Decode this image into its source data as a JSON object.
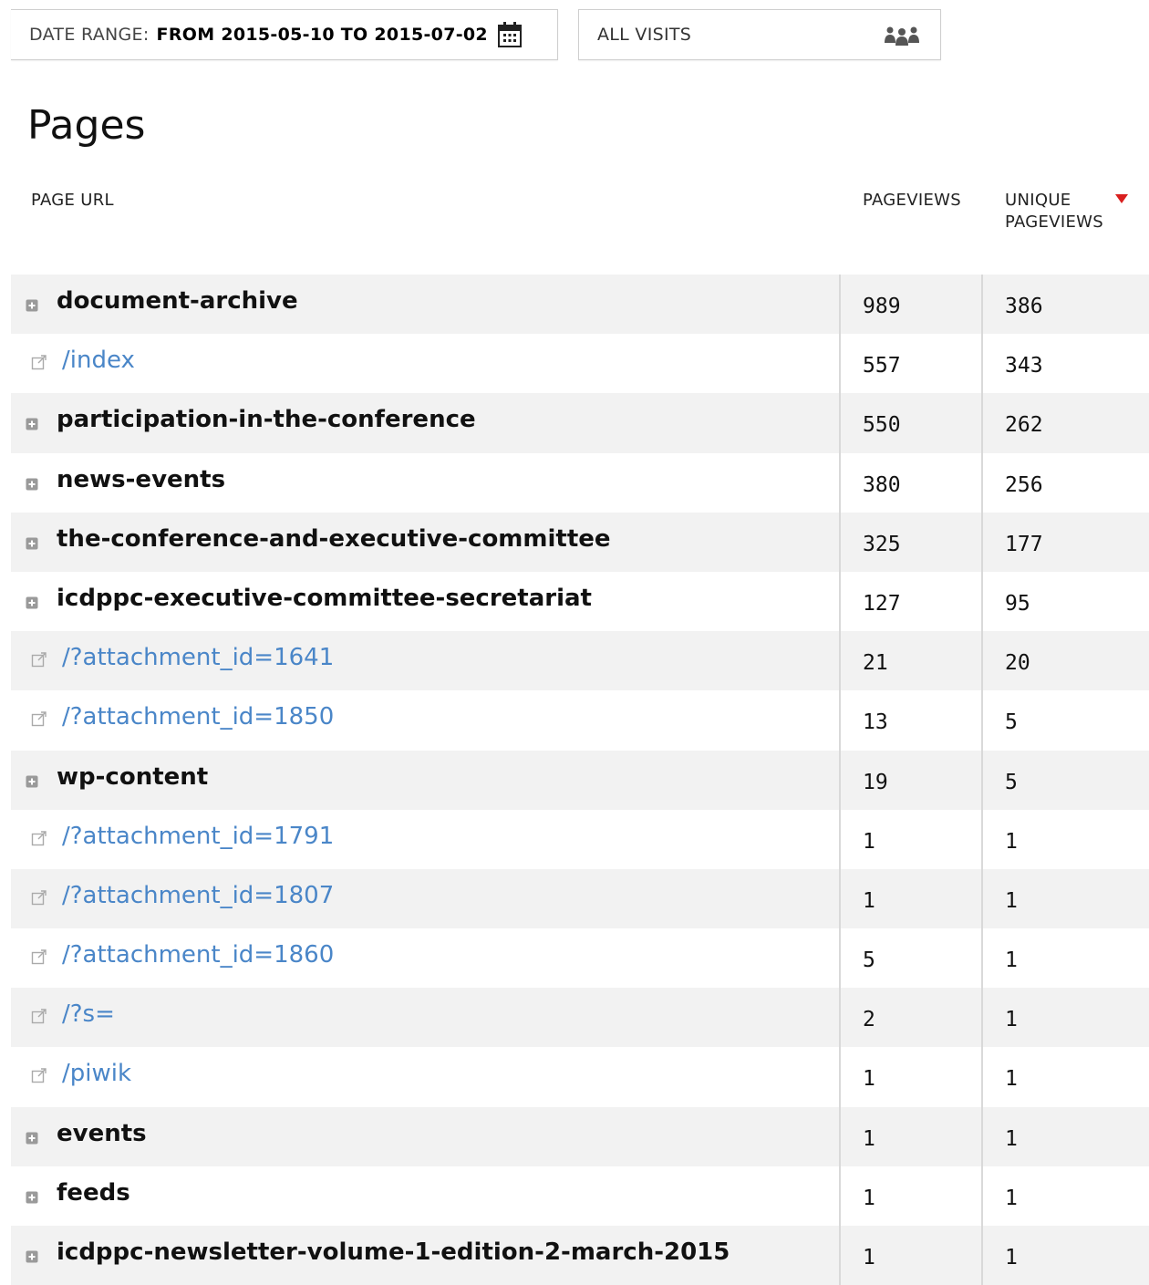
{
  "filters": {
    "date_label": "DATE RANGE:",
    "date_value": "FROM 2015-05-10 TO 2015-07-02",
    "segment_label": "ALL VISITS"
  },
  "title": "Pages",
  "columns": {
    "url": "PAGE URL",
    "pageviews": "PAGEVIEWS",
    "unique_pageviews": "UNIQUE PAGEVIEWS"
  },
  "rows": [
    {
      "kind": "folder",
      "label": "document-archive",
      "pageviews": "989",
      "unique": "386"
    },
    {
      "kind": "link",
      "label": "/index",
      "pageviews": "557",
      "unique": "343"
    },
    {
      "kind": "folder",
      "label": "participation-in-the-conference",
      "pageviews": "550",
      "unique": "262"
    },
    {
      "kind": "folder",
      "label": "news-events",
      "pageviews": "380",
      "unique": "256"
    },
    {
      "kind": "folder",
      "label": "the-conference-and-executive-committee",
      "pageviews": "325",
      "unique": "177"
    },
    {
      "kind": "folder",
      "label": "icdppc-executive-committee-secretariat",
      "pageviews": "127",
      "unique": "95"
    },
    {
      "kind": "link",
      "label": "/?attachment_id=1641",
      "pageviews": "21",
      "unique": "20"
    },
    {
      "kind": "link",
      "label": "/?attachment_id=1850",
      "pageviews": "13",
      "unique": "5"
    },
    {
      "kind": "folder",
      "label": "wp-content",
      "pageviews": "19",
      "unique": "5"
    },
    {
      "kind": "link",
      "label": "/?attachment_id=1791",
      "pageviews": "1",
      "unique": "1"
    },
    {
      "kind": "link",
      "label": "/?attachment_id=1807",
      "pageviews": "1",
      "unique": "1"
    },
    {
      "kind": "link",
      "label": "/?attachment_id=1860",
      "pageviews": "5",
      "unique": "1"
    },
    {
      "kind": "link",
      "label": "/?s=",
      "pageviews": "2",
      "unique": "1"
    },
    {
      "kind": "link",
      "label": "/piwik",
      "pageviews": "1",
      "unique": "1"
    },
    {
      "kind": "folder",
      "label": "events",
      "pageviews": "1",
      "unique": "1"
    },
    {
      "kind": "folder",
      "label": "feeds",
      "pageviews": "1",
      "unique": "1"
    },
    {
      "kind": "folder",
      "label": "icdppc-newsletter-volume-1-edition-2-march-2015",
      "pageviews": "1",
      "unique": "1"
    }
  ],
  "icons": {
    "calendar": "calendar-icon",
    "segment": "visitors-icon",
    "sort": "sort-desc-icon",
    "expand": "expand-plus-icon",
    "external": "external-link-icon"
  },
  "colors": {
    "link": "#4a86c8",
    "sort_arrow": "#d9201f",
    "row_alt": "#f2f2f2"
  }
}
